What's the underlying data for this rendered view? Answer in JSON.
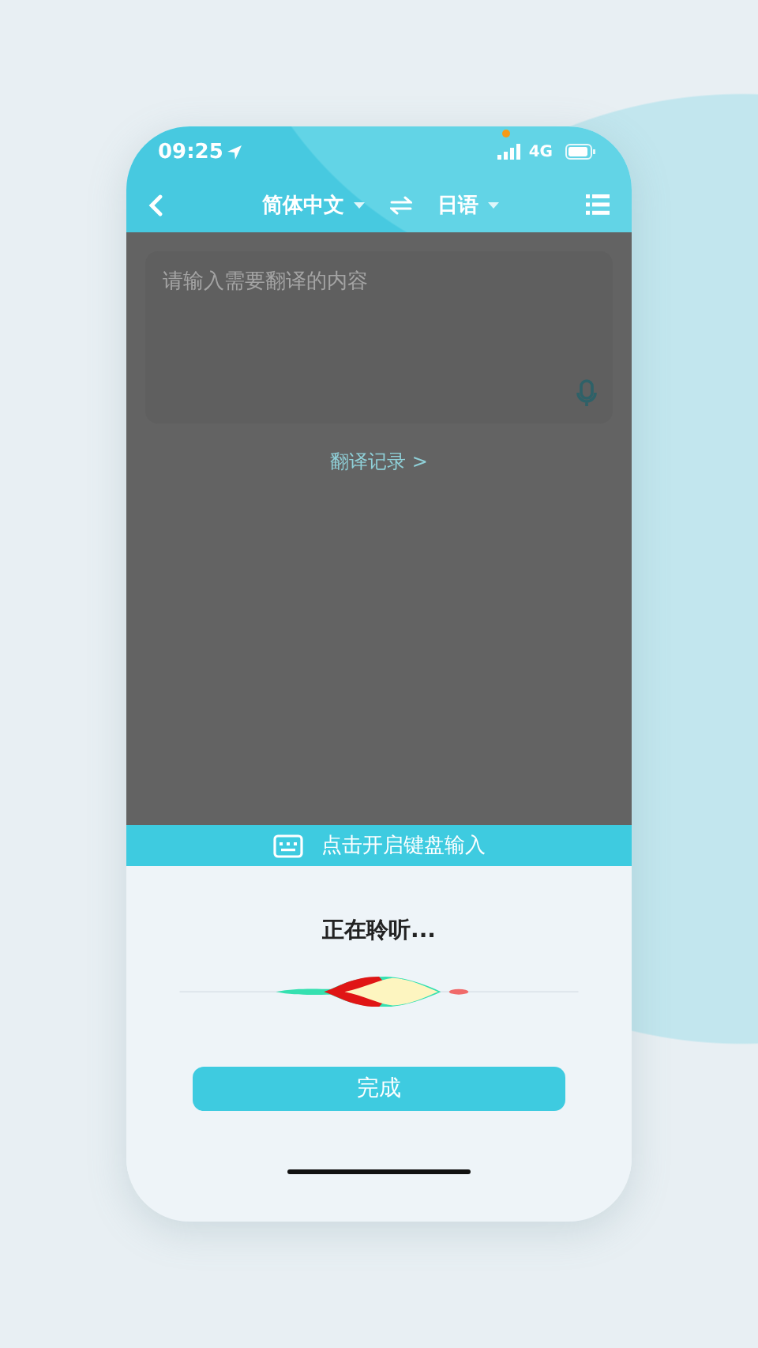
{
  "status_bar": {
    "time": "09:25",
    "network": "4G"
  },
  "header": {
    "source_language": "简体中文",
    "target_language": "日语"
  },
  "input": {
    "placeholder": "请输入需要翻译的内容"
  },
  "history_link": "翻译记录 >",
  "keyboard_bar": {
    "label": "点击开启键盘输入"
  },
  "listening": {
    "status": "正在聆听..."
  },
  "done_button": "完成"
}
